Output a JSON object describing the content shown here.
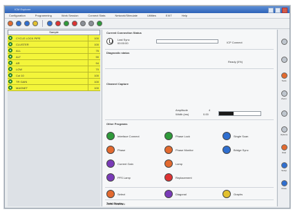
{
  "window": {
    "title": "ICM Explorer"
  },
  "menubar": {
    "items": [
      "Configuration",
      "Programming",
      "Work Session",
      "Connect Stats",
      "Network/Stimulate",
      "Utilities",
      "EXIT",
      "Help"
    ]
  },
  "toolbar": {
    "icons": [
      "blue-orange-icon",
      "blue-circle-icon",
      "orange-circle-icon",
      "yellow-circle-icon",
      "blue-circle-icon",
      "red-circle-icon",
      "green-circle-icon",
      "red-circle-icon",
      "gray-circle-icon",
      "gray-circle-icon",
      "green-circle-icon"
    ]
  },
  "left_panel": {
    "header": "Sample",
    "rows": [
      {
        "name": "CYCLE LOCK PIPE",
        "value": "100"
      },
      {
        "name": "CLUSTER",
        "value": "100"
      },
      {
        "name": "ALL",
        "value": "76"
      },
      {
        "name": "ALT",
        "value": "90"
      },
      {
        "name": "AR",
        "value": "94"
      },
      {
        "name": "LOW",
        "value": "70"
      },
      {
        "name": "Cut 10",
        "value": "100"
      },
      {
        "name": "TR GAIN",
        "value": "100"
      },
      {
        "name": "MAGNET",
        "value": "100"
      }
    ],
    "bottom_buttons": [
      "info-icon",
      "orange-icon",
      "gray-icon"
    ],
    "mini_scroll_label": "−"
  },
  "main": {
    "section_connection": "Current Connection Status",
    "last_sync_label": "Last Sync",
    "last_sync_value": "00:00:00",
    "status_text": "ICP Connect",
    "section_diagnostic": "Diagnostic status",
    "ready_label": "Ready (0%)",
    "section_devices": "Channel Capture",
    "amplitude_label": "Amplitude",
    "amplitude_value": "4",
    "width_label": "Width (ms)",
    "width_value": "0.00",
    "slider_fill_percent": 35,
    "section_other": "Other Programs",
    "grid_items": [
      {
        "label": "Interface Connect",
        "icon": "green-circle-icon",
        "color": "#2f9a3a"
      },
      {
        "label": "Phase Lock",
        "icon": "green-circle-icon",
        "color": "#2f9a3a"
      },
      {
        "label": "Single Scan",
        "icon": "blue-circle-icon",
        "color": "#2f6fd0"
      },
      {
        "label": "Phase",
        "icon": "orange-circle-icon",
        "color": "#e36a2f"
      },
      {
        "label": "Phase Monitor",
        "icon": "orange-circle-icon",
        "color": "#e36a2f"
      },
      {
        "label": "Bridge Sync",
        "icon": "blue-circle-icon",
        "color": "#2f6fd0"
      },
      {
        "label": "Current Gain",
        "icon": "purple-circle-icon",
        "color": "#7a3bb8"
      },
      {
        "label": "Lamp",
        "icon": "orange-circle-icon",
        "color": "#e36a2f"
      },
      {
        "label": "",
        "icon": "",
        "color": ""
      },
      {
        "label": "PFS Lamp",
        "icon": "purple-circle-icon",
        "color": "#7a3bb8"
      },
      {
        "label": "Replacement",
        "icon": "red-circle-icon",
        "color": "#d33"
      },
      {
        "label": "",
        "icon": "",
        "color": ""
      }
    ],
    "section_footer": "Total Display",
    "footer_items": [
      {
        "label": "Select",
        "icon": "orange-circle-icon",
        "color": "#e36a2f"
      },
      {
        "label": "Diagonal",
        "icon": "purple-circle-icon",
        "color": "#7a3bb8"
      },
      {
        "label": "Graphs",
        "icon": "yellow-circle-icon",
        "color": "#e3c12f"
      }
    ],
    "bottom_label": "Other Selected"
  },
  "right_toolbar": {
    "items": [
      {
        "label": "",
        "icon": "gray-circle-icon"
      },
      {
        "label": "",
        "icon": "gray-circle-icon"
      },
      {
        "label": "Tools",
        "icon": "orange-circle-icon"
      },
      {
        "label": "Zoom",
        "icon": "gray-circle-icon"
      },
      {
        "label": "",
        "icon": "gray-circle-icon"
      },
      {
        "label": "Options",
        "icon": "gray-circle-icon"
      },
      {
        "label": "Help",
        "icon": "orange-circle-icon"
      },
      {
        "label": "Setup",
        "icon": "blue-circle-icon"
      },
      {
        "label": "Close",
        "icon": "blue-circle-icon"
      }
    ]
  }
}
